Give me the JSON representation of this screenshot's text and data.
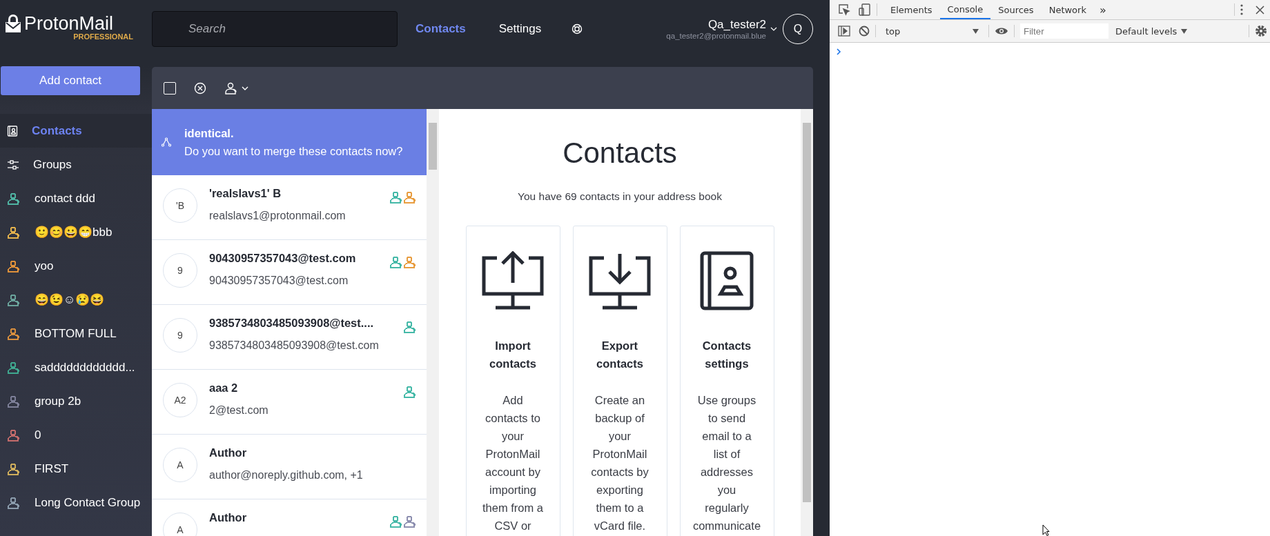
{
  "logo": {
    "name": "ProtonMail",
    "plan": "PROFESSIONAL"
  },
  "search": {
    "placeholder": "Search"
  },
  "nav": [
    {
      "label": "Contacts",
      "selected": true
    },
    {
      "label": "Settings",
      "selected": false
    }
  ],
  "user": {
    "name": "Qa_tester2",
    "email": "qa_tester2@protonmail.blue",
    "initial": "Q"
  },
  "sidebar": {
    "button": "Add contact",
    "items": [
      {
        "label": "Contacts",
        "kind": "contacts",
        "selected": true
      },
      {
        "label": "Groups",
        "kind": "groups",
        "selected": false
      },
      {
        "label": "contact ddd",
        "kind": "group",
        "selected": false,
        "color": "#4fb3a2"
      },
      {
        "label": "🙂😊😀😁bbb",
        "kind": "group",
        "selected": false,
        "color": "#e3b14c"
      },
      {
        "label": "yoo",
        "kind": "group",
        "selected": false,
        "color": "#e0913a"
      },
      {
        "label": "😄😉☺😢😆",
        "kind": "group",
        "selected": false,
        "color": "#6aa39b"
      },
      {
        "label": "BOTTOM FULL",
        "kind": "group",
        "selected": false,
        "color": "#d98f3e"
      },
      {
        "label": "sadddddddddddd...",
        "kind": "group",
        "selected": false,
        "color": "#3fa88f"
      },
      {
        "label": "group 2b",
        "kind": "group",
        "selected": false,
        "color": "#7d7f98"
      },
      {
        "label": "0",
        "kind": "group",
        "selected": false,
        "color": "#c46b6b"
      },
      {
        "label": "FIRST",
        "kind": "group",
        "selected": false,
        "color": "#cfae5c"
      },
      {
        "label": "Long Contact Group",
        "kind": "group",
        "selected": false,
        "color": "#8b9cac"
      }
    ]
  },
  "select_all": {
    "checked": false
  },
  "merge_banner": {
    "title": "identical.",
    "text": "Do you want to merge these contacts now?"
  },
  "contacts": [
    {
      "initials": "'B",
      "name": "'realslavs1' B",
      "email": "realslavs1@protonmail.com",
      "groups": [
        {
          "color": "#45b9a8"
        },
        {
          "color": "#e89d40"
        }
      ]
    },
    {
      "initials": "9",
      "name": "90430957357043@test.com",
      "email": "90430957357043@test.com",
      "groups": [
        {
          "color": "#45b9a8"
        },
        {
          "color": "#e89d40"
        }
      ]
    },
    {
      "initials": "9",
      "name": "9385734803485093908@test....",
      "email": "9385734803485093908@test.com",
      "groups": [
        {
          "color": "#45b9a8"
        }
      ]
    },
    {
      "initials": "A2",
      "name": "aaa 2",
      "email": "2@test.com",
      "groups": [
        {
          "color": "#45b9a8"
        }
      ]
    },
    {
      "initials": "A",
      "name": "Author",
      "email": "author@noreply.github.com, +1"
    },
    {
      "initials": "A",
      "name": "Author",
      "groups": [
        {
          "color": "#45b9a8"
        },
        {
          "color": "#8d8fb0"
        }
      ]
    }
  ],
  "panel": {
    "title": "Contacts",
    "subtitle": "You have 69 contacts in your address book",
    "cards": [
      {
        "kind": "import",
        "title": "Import contacts",
        "description_lines": [
          "Add",
          "contacts to",
          "your",
          "ProtonMail",
          "account by",
          "importing",
          "them from a",
          "CSV or"
        ]
      },
      {
        "kind": "export",
        "title": "Export contacts",
        "description_lines": [
          "Create an",
          "backup of",
          "your",
          "ProtonMail",
          "contacts by",
          "exporting",
          "them to a",
          "vCard file."
        ]
      },
      {
        "kind": "settings",
        "title": "Contacts settings",
        "description_lines": [
          "Use groups",
          "to send",
          "email to a",
          "list of",
          "addresses",
          "you",
          "regularly",
          "communicate"
        ]
      }
    ]
  },
  "devtools": {
    "tabs": [
      {
        "label": "Elements",
        "selected": false
      },
      {
        "label": "Console",
        "selected": true
      },
      {
        "label": "Sources",
        "selected": false
      },
      {
        "label": "Network",
        "selected": false
      }
    ],
    "more": "»",
    "context": "top",
    "filter_placeholder": "Filter",
    "levels": "Default levels"
  }
}
